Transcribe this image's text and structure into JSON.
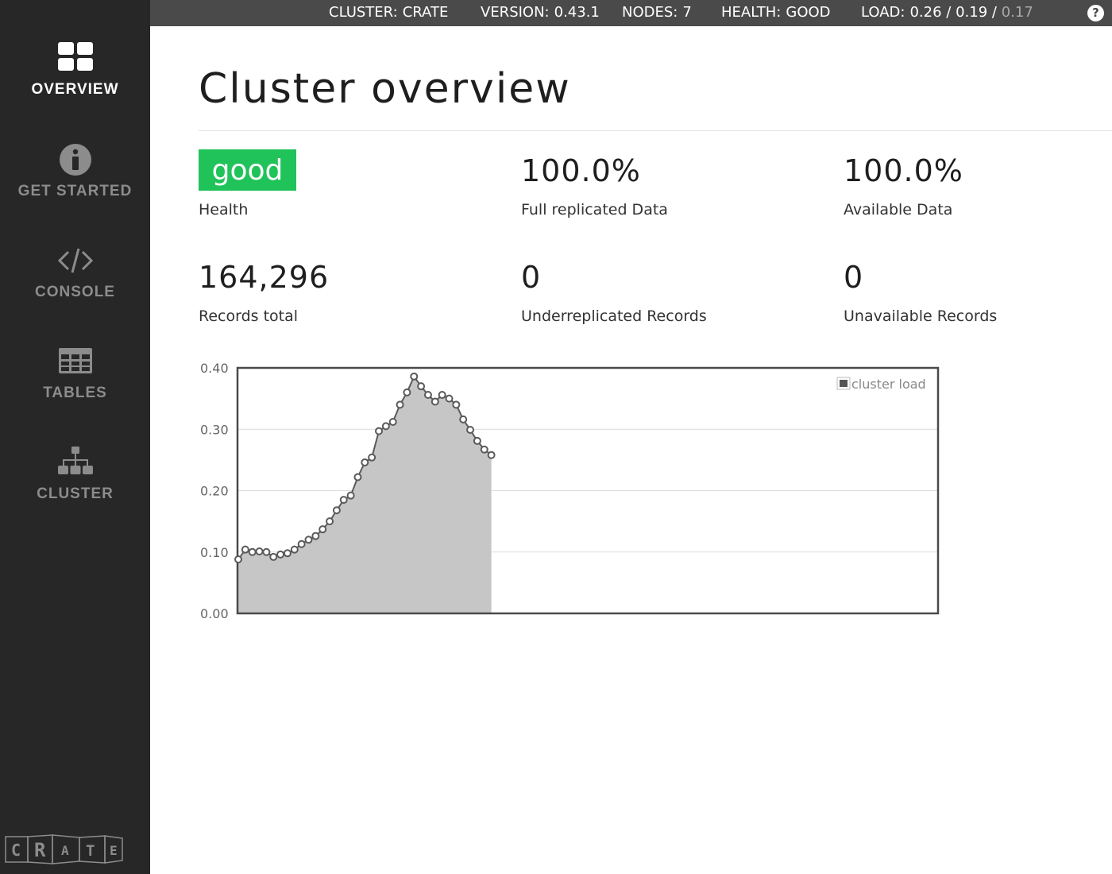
{
  "sidebar": {
    "items": [
      {
        "label": "OVERVIEW",
        "icon": "grid-icon",
        "active": true
      },
      {
        "label": "GET STARTED",
        "icon": "info-icon",
        "active": false
      },
      {
        "label": "CONSOLE",
        "icon": "code-icon",
        "active": false
      },
      {
        "label": "TABLES",
        "icon": "table-icon",
        "active": false
      },
      {
        "label": "CLUSTER",
        "icon": "cluster-icon",
        "active": false
      }
    ],
    "logo_text": "CRATE"
  },
  "topbar": {
    "cluster_label": "CLUSTER:",
    "cluster_value": "CRATE",
    "version_label": "VERSION:",
    "version_value": "0.43.1",
    "nodes_label": "NODES:",
    "nodes_value": "7",
    "health_label": "HEALTH:",
    "health_value": "GOOD",
    "load_label": "LOAD:",
    "load_1": "0.26",
    "load_sep1": "/",
    "load_5": "0.19",
    "load_sep2": "/",
    "load_15": "0.17",
    "help": "?"
  },
  "main": {
    "title": "Cluster overview",
    "stats": {
      "health_value": "good",
      "health_label": "Health",
      "full_replicated_value": "100.0%",
      "full_replicated_label": "Full replicated Data",
      "available_value": "100.0%",
      "available_label": "Available Data",
      "records_total_value": "164,296",
      "records_total_label": "Records total",
      "underreplicated_value": "0",
      "underreplicated_label": "Underreplicated Records",
      "unavailable_value": "0",
      "unavailable_label": "Unavailable Records"
    }
  },
  "colors": {
    "health_good": "#20c35a",
    "sidebar_bg": "#272727",
    "topbar_bg": "#4a4a4a",
    "area_fill": "#c6c6c6",
    "line": "#5a5a5a"
  },
  "chart_data": {
    "type": "area",
    "title": "",
    "xlabel": "",
    "ylabel": "",
    "ylim": [
      0,
      0.4
    ],
    "yticks": [
      "0.00",
      "0.10",
      "0.20",
      "0.30",
      "0.40"
    ],
    "grid": true,
    "legend_position": "top-right",
    "series": [
      {
        "name": "cluster load",
        "values": [
          0.088,
          0.104,
          0.1,
          0.101,
          0.1,
          0.092,
          0.096,
          0.098,
          0.104,
          0.113,
          0.12,
          0.126,
          0.137,
          0.15,
          0.168,
          0.185,
          0.192,
          0.222,
          0.246,
          0.254,
          0.297,
          0.305,
          0.312,
          0.34,
          0.36,
          0.386,
          0.37,
          0.356,
          0.345,
          0.356,
          0.35,
          0.34,
          0.316,
          0.299,
          0.281,
          0.267,
          0.258
        ]
      }
    ],
    "x_capacity": 100
  }
}
